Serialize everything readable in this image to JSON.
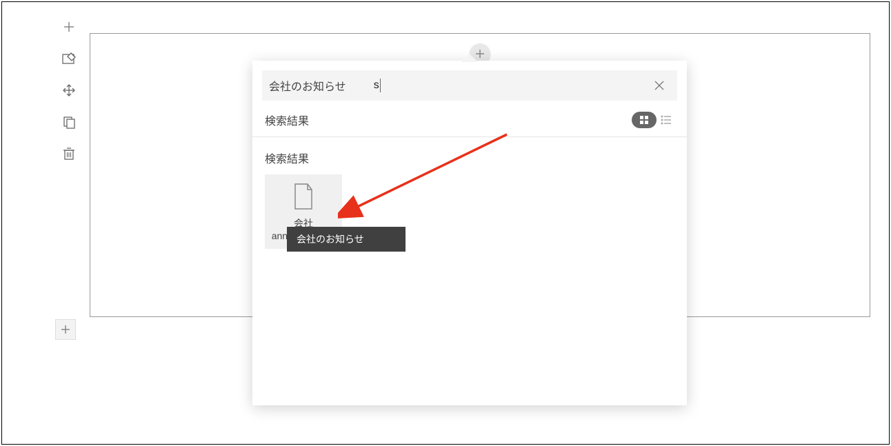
{
  "toolbar": {
    "add_top": "+",
    "edit": "edit",
    "move": "move",
    "copy": "copy",
    "delete": "delete",
    "add_bottom": "+"
  },
  "canvas": {
    "plus_top": "+"
  },
  "popover": {
    "search_label": "会社のお知らせ",
    "search_value": "s",
    "close": "×",
    "header_label": "検索結果",
    "view_grid": "grid",
    "view_list": "list",
    "body_label": "検索結果",
    "result": {
      "line1": "会社",
      "line2": "announceme...",
      "tooltip": "会社のお知らせ"
    }
  }
}
